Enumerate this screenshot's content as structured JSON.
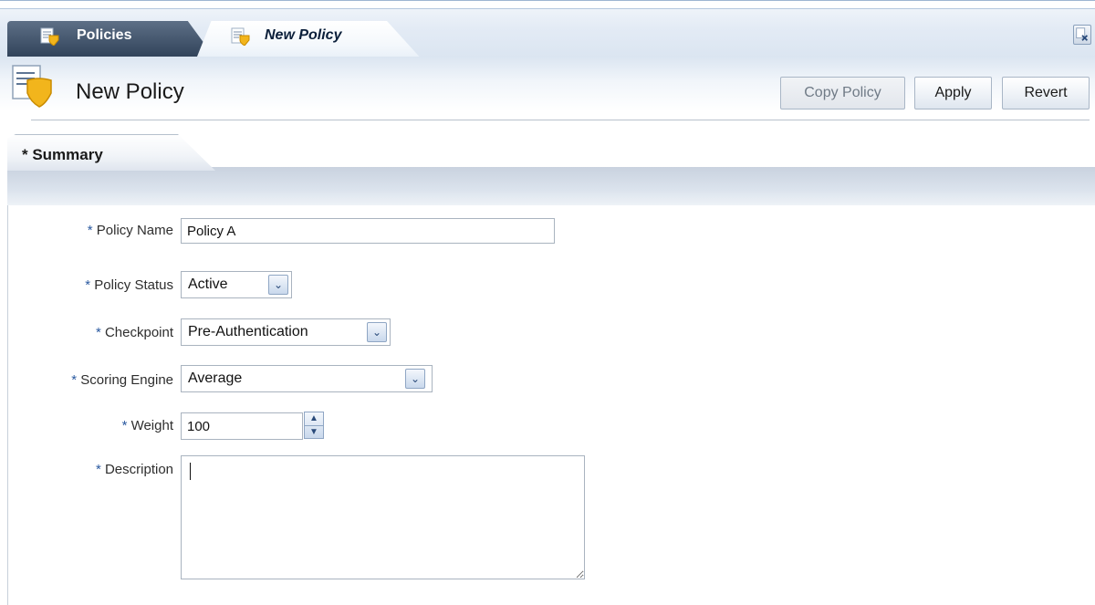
{
  "tabs": [
    {
      "label": "Policies",
      "icon": "policy-document-icon",
      "active": false
    },
    {
      "label": "New Policy",
      "icon": "policy-document-icon",
      "active": true
    }
  ],
  "header": {
    "title": "New Policy",
    "icon": "policy-shield-icon",
    "buttons": {
      "copy_policy": "Copy Policy",
      "apply": "Apply",
      "revert": "Revert"
    }
  },
  "summary_tab": {
    "label": "* Summary"
  },
  "form": {
    "required_mark": "*",
    "policy_name": {
      "label": "Policy Name",
      "value": "Policy A"
    },
    "policy_status": {
      "label": "Policy Status",
      "value": "Active"
    },
    "checkpoint": {
      "label": "Checkpoint",
      "value": "Pre-Authentication"
    },
    "scoring_engine": {
      "label": "Scoring Engine",
      "value": "Average"
    },
    "weight": {
      "label": "Weight",
      "value": "100"
    },
    "description": {
      "label": "Description",
      "value": ""
    }
  },
  "colors": {
    "accent": "#2b5aa0",
    "tab_dark": "#2c3e55",
    "icon_gold": "#f2b51c"
  }
}
